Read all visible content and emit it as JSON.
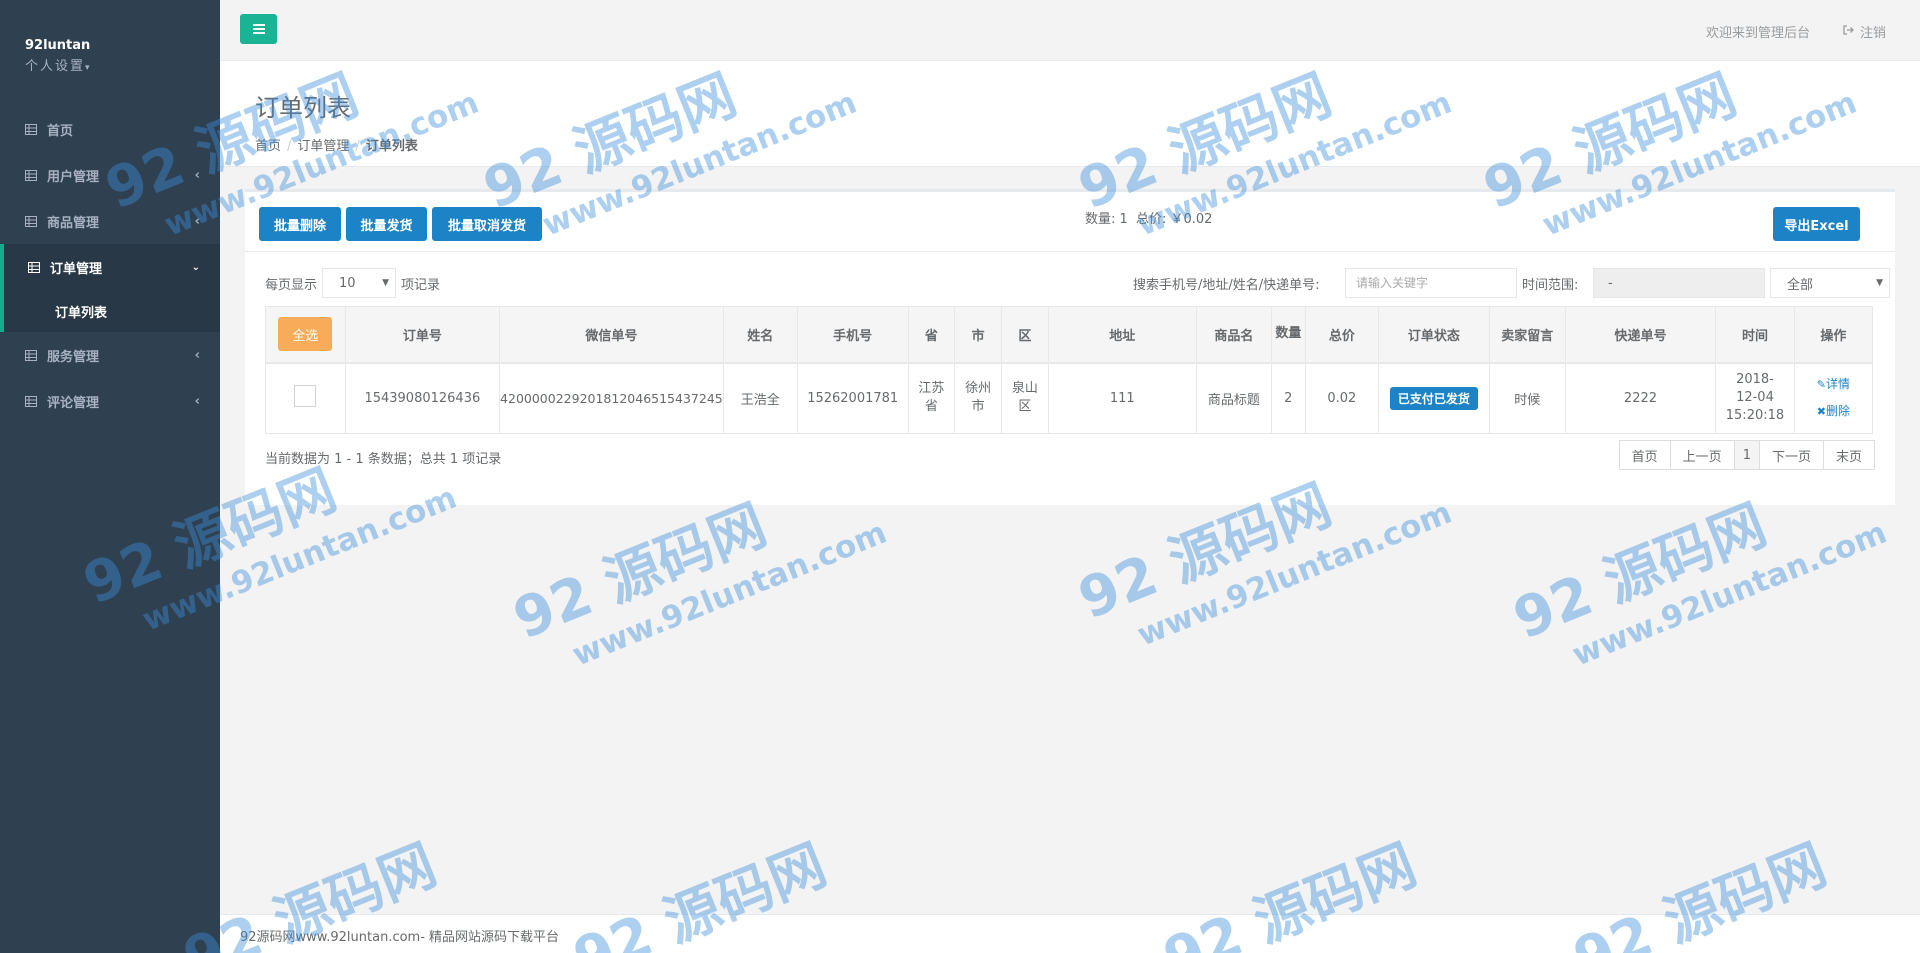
{
  "sidebar": {
    "username": "92luntan",
    "settings_label": "个人设置",
    "items": [
      {
        "label": "首页",
        "has_arrow": false
      },
      {
        "label": "用户管理",
        "has_arrow": true
      },
      {
        "label": "商品管理",
        "has_arrow": true
      },
      {
        "label": "订单管理",
        "has_arrow": true,
        "active": true,
        "children": [
          {
            "label": "订单列表"
          }
        ]
      },
      {
        "label": "服务管理",
        "has_arrow": true
      },
      {
        "label": "评论管理",
        "has_arrow": true
      }
    ]
  },
  "topbar": {
    "welcome": "欢迎来到管理后台",
    "logout": "注销"
  },
  "heading": {
    "title": "订单列表",
    "breadcrumb": [
      "首页",
      "订单管理",
      "订单列表"
    ]
  },
  "actions": {
    "batch_delete": "批量删除",
    "batch_ship": "批量发货",
    "batch_cancel_ship": "批量取消发货",
    "export": "导出Excel"
  },
  "summary": {
    "count_label": "数量: 1",
    "total_label": "总价: ￥0.02"
  },
  "filters": {
    "per_page_prefix": "每页显示",
    "per_page_value": "10",
    "per_page_suffix": "项记录",
    "search_label": "搜索手机号/地址/姓名/快递单号:",
    "search_placeholder": "请输入关键字",
    "range_label": "时间范围:",
    "range_value": "-",
    "status_value": "全部"
  },
  "table": {
    "select_all": "全选",
    "columns": [
      "订单号",
      "微信单号",
      "姓名",
      "手机号",
      "省",
      "市",
      "区",
      "地址",
      "商品名",
      "数量",
      "总价",
      "订单状态",
      "卖家留言",
      "快递单号",
      "时间",
      "操作"
    ],
    "rows": [
      {
        "order_no": "15439080126436",
        "wechat_no": "4200000229201812046515437245",
        "name": "王浩全",
        "phone": "15262001781",
        "province": "江苏省",
        "city": "徐州市",
        "district": "泉山区",
        "address": "111",
        "product": "商品标题",
        "qty": "2",
        "total": "0.02",
        "status": "已支付已发货",
        "seller_note": "时候",
        "express_no": "2222",
        "time_date": "2018-12-04",
        "time_clock": "15:20:18",
        "op_detail": "详情",
        "op_delete": "删除"
      }
    ]
  },
  "pagination": {
    "info": "当前数据为 1 - 1 条数据；总共 1 项记录",
    "first": "首页",
    "prev": "上一页",
    "current": "1",
    "next": "下一页",
    "last": "末页"
  },
  "footer": {
    "text": "92源码网www.92luntan.com- 精品网站源码下载平台"
  },
  "watermark": {
    "big": "92 源码网",
    "small": "www.92luntan.com"
  },
  "colors": {
    "sidebar_bg": "#2f4050",
    "accent_green": "#1ab394",
    "primary_blue": "#1c84c6",
    "warning_orange": "#f8ac59"
  }
}
